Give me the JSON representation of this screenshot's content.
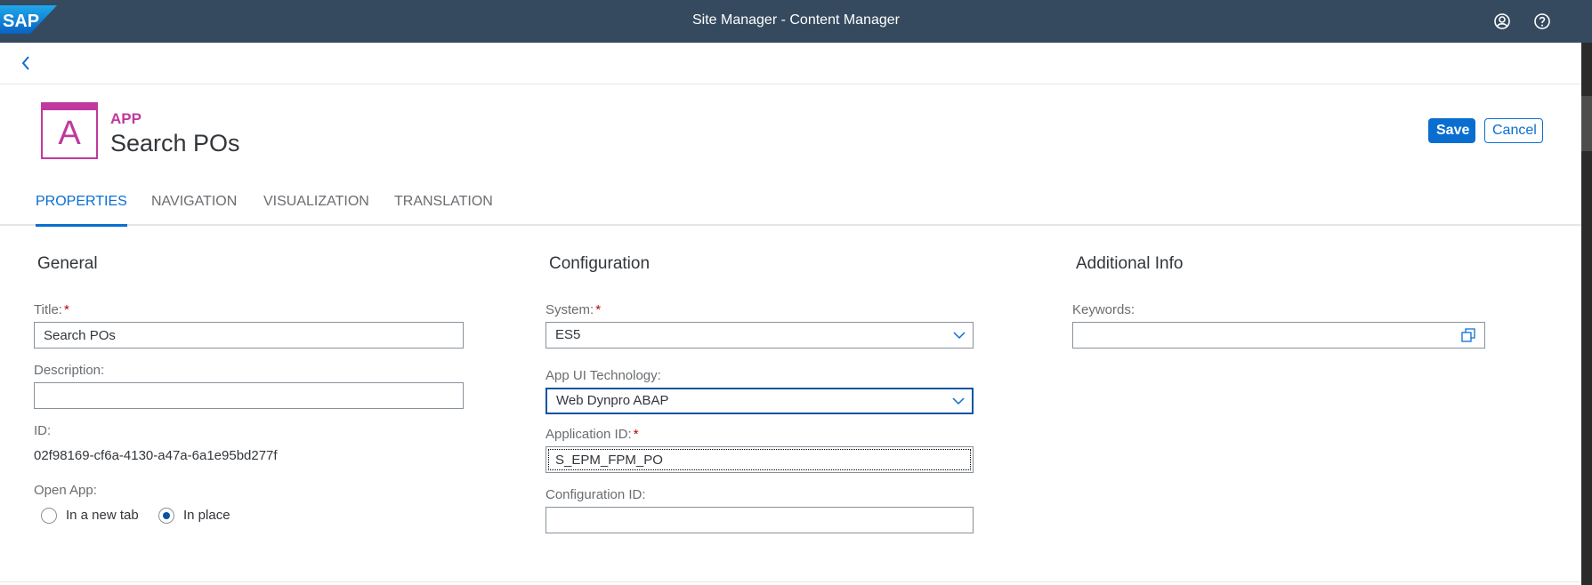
{
  "shell": {
    "logo": "SAP",
    "title": "Site Manager - Content Manager",
    "icons": [
      "user-icon",
      "help-icon"
    ]
  },
  "nav": {
    "back_icon": "chevron-left-icon"
  },
  "header": {
    "avatar_letter": "A",
    "type": "APP",
    "title": "Search POs",
    "save": "Save",
    "cancel": "Cancel"
  },
  "tabs": [
    "PROPERTIES",
    "NAVIGATION",
    "VISUALIZATION",
    "TRANSLATION"
  ],
  "general": {
    "title": "General",
    "title_label": "Title:",
    "title_value": "Search POs",
    "description_label": "Description:",
    "description_value": "",
    "id_label": "ID:",
    "id_value": "02f98169-cf6a-4130-a47a-6a1e95bd277f",
    "open_app_label": "Open App:",
    "option_new_tab": "In a new tab",
    "option_in_place": "In place",
    "selected_option": "In place"
  },
  "configuration": {
    "title": "Configuration",
    "system_label": "System:",
    "system_value": "ES5",
    "tech_label": "App UI Technology:",
    "tech_value": "Web Dynpro ABAP",
    "appid_label": "Application ID:",
    "appid_value": "S_EPM_FPM_PO",
    "configid_label": "Configuration ID:",
    "configid_value": ""
  },
  "additional": {
    "title": "Additional Info",
    "keywords_label": "Keywords:",
    "keywords_value": ""
  },
  "colors": {
    "shell": "#354a5f",
    "accent": "#0a6ed1",
    "app_icon": "#c0399f",
    "required": "#bb0000"
  }
}
